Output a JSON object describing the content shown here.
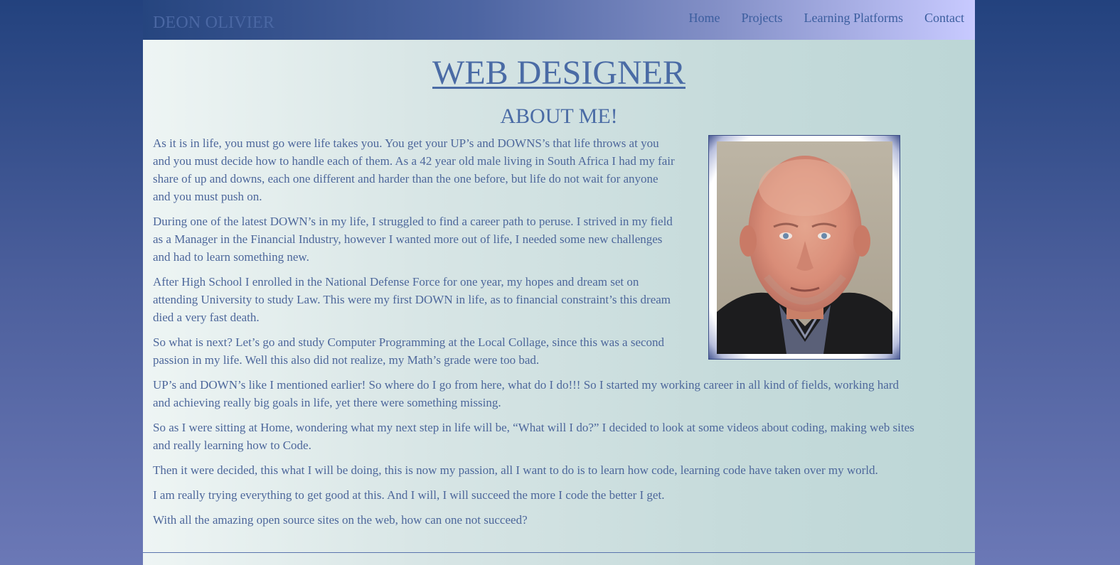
{
  "header": {
    "brand": "DEON OLIVIER",
    "nav": [
      "Home",
      "Projects",
      "Learning Platforms",
      "Contact"
    ]
  },
  "main": {
    "title": "WEB DESIGNER",
    "subtitle": "ABOUT ME!",
    "photo_alt": "Portrait photo of Deon Olivier",
    "paragraphs": [
      "As it is in life, you must go were life takes you. You get your UP’s and DOWNS’s that life throws at you and you must decide how to handle each of them. As a 42 year old male living in South Africa I had my fair share of up and downs, each one different and harder than the one before, but life do not wait for anyone and you must push on.",
      "During one of the latest DOWN’s in my life, I struggled to find a career path to peruse. I strived in my field as a Manager in the Financial Industry, however I wanted more out of life, I needed some new challenges and had to learn something new.",
      "After High School I enrolled in the National Defense Force for one year, my hopes and dream set on attending University to study Law. This were my first DOWN in life, as to financial constraint’s this dream died a very fast death.",
      "So what is next? Let’s go and study Computer Programming at the Local Collage, since this was a second passion in my life. Well this also did not realize, my Math’s grade were too bad.",
      "UP’s and DOWN’s like I mentioned earlier! So where do I go from here, what do I do!!! So I started my working career in all kind of fields, working hard and achieving really big goals in life, yet there were something missing.",
      "So as I were sitting at Home, wondering what my next step in life will be, “What will I do?” I decided to look at some videos about coding, making web sites and really learning how to Code.",
      "Then it were decided, this what I will be doing, this is now my passion, all I want to do is to learn how code, learning code have taken over my world.",
      "I am really trying everything to get good at this. And I will, I will succeed the more I code the better I get.",
      "With all the amazing open source sites on the web, how can one not succeed?"
    ]
  },
  "colors": {
    "text": "#4d679b",
    "heading": "#4a6ba5",
    "nav": "#3b5d9e"
  }
}
